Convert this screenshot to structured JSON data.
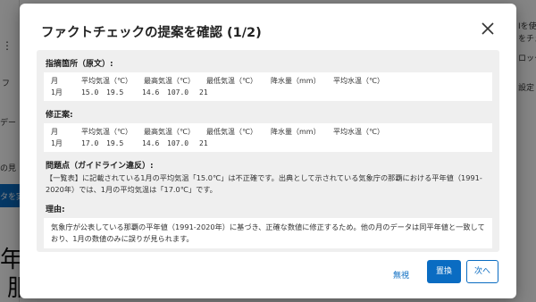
{
  "background": {
    "right_fragments": [
      "Iを使",
      "をチェ",
      "ロック",
      "設定"
    ],
    "left_fragments": [
      "フ",
      "デー",
      "の見",
      "タを実"
    ],
    "big_text": [
      "年間",
      "服"
    ],
    "menu_icon": "kebab-icon"
  },
  "modal": {
    "title": "ファクトチェックの提案を確認 (1/2)",
    "original": {
      "label": "指摘箇所（原文）:",
      "headers": [
        "月",
        "平均気温（℃）",
        "最高気温（℃）",
        "最低気温（℃）",
        "降水量（mm）",
        "平均水温（℃）"
      ],
      "values": [
        "1月",
        "15.0",
        "19.5",
        "14.6",
        "107.0",
        "21"
      ]
    },
    "correction": {
      "label": "修正案:",
      "headers": [
        "月",
        "平均気温（℃）",
        "最高気温（℃）",
        "最低気温（℃）",
        "降水量（mm）",
        "平均水温（℃）"
      ],
      "values": [
        "1月",
        "17.0",
        "19.5",
        "14.6",
        "107.0",
        "21"
      ]
    },
    "issue": {
      "label": "問題点（ガイドライン違反）:",
      "text": "【一覧表】に記載されている1月の平均気温「15.0℃」は不正確です。出典として示されている気象庁の那覇における平年値（1991-2020年）では、1月の平均気温は「17.0℃」です。"
    },
    "reason": {
      "label": "理由:",
      "text": "気象庁が公表している那覇の平年値（1991-2020年）に基づき、正確な数値に修正するため。他の月のデータは同平年値と一致しており、1月の数値のみに誤りが見られます。"
    },
    "buttons": {
      "ignore": "無視",
      "replace": "置換",
      "next": "次へ"
    }
  },
  "colors": {
    "accent": "#0a6cc2",
    "panel_bg": "#efefef"
  }
}
